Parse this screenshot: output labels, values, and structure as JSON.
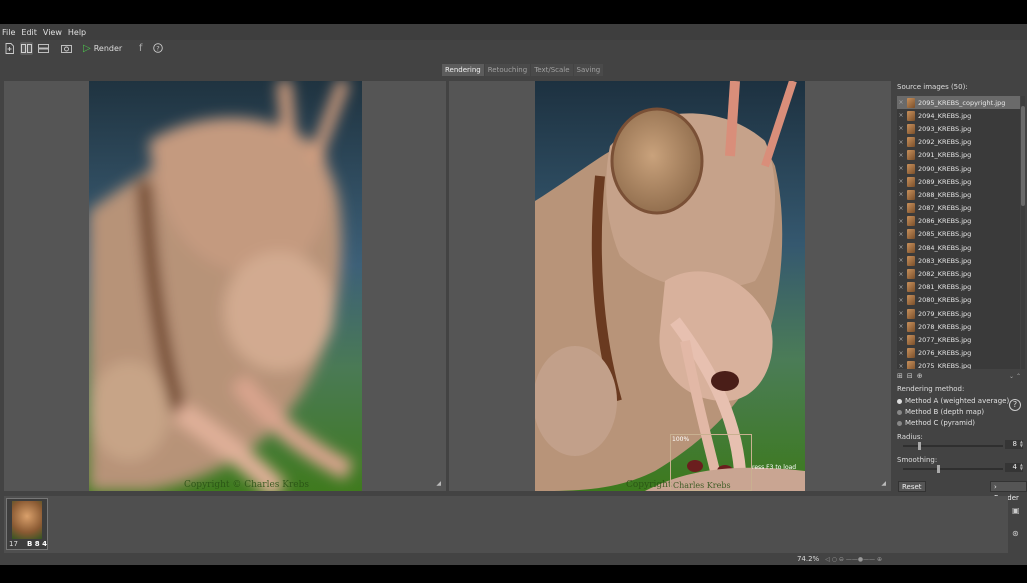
{
  "menu": [
    "File",
    "Edit",
    "View",
    "Help"
  ],
  "toolbar": {
    "icons": [
      "new-document-icon",
      "two-column-view-icon",
      "two-row-view-icon",
      "snapshot-icon",
      "play-icon",
      "facebook-icon",
      "help-icon"
    ],
    "render_label": "Render"
  },
  "tabs": [
    {
      "label": "Rendering",
      "active": true
    },
    {
      "label": "Retouching",
      "active": false
    },
    {
      "label": "Text/Scale",
      "active": false
    },
    {
      "label": "Saving",
      "active": false
    }
  ],
  "left_view": {
    "copyright": "Copyright © Charles Krebs"
  },
  "right_view": {
    "copyright": "Copyright",
    "loupe_zoom": "100%",
    "loupe_hint": "ress F3 to load",
    "loupe_text": "Charles Krebs"
  },
  "sidebar": {
    "title": "Source images (50):",
    "files": [
      "2095_KREBS_copyright.jpg",
      "2094_KREBS.jpg",
      "2093_KREBS.jpg",
      "2092_KREBS.jpg",
      "2091_KREBS.jpg",
      "2090_KREBS.jpg",
      "2089_KREBS.jpg",
      "2088_KREBS.jpg",
      "2087_KREBS.jpg",
      "2086_KREBS.jpg",
      "2085_KREBS.jpg",
      "2084_KREBS.jpg",
      "2083_KREBS.jpg",
      "2082_KREBS.jpg",
      "2081_KREBS.jpg",
      "2080_KREBS.jpg",
      "2079_KREBS.jpg",
      "2078_KREBS.jpg",
      "2077_KREBS.jpg",
      "2076_KREBS.jpg",
      "2075_KREBS.jpg"
    ],
    "selected_index": 0,
    "method_title": "Rendering method:",
    "methods": [
      "Method A (weighted average)",
      "Method B (depth map)",
      "Method C (pyramid)"
    ],
    "selected_method": 0,
    "radius_label": "Radius:",
    "radius_value": "8",
    "radius_fraction": 0.15,
    "smoothing_label": "Smoothing:",
    "smoothing_value": "4",
    "smoothing_fraction": 0.35,
    "reset_label": "Reset",
    "render_label": "› Render"
  },
  "filmstrip": {
    "thumb_label": "17",
    "thumb_badge": "B 8 4"
  },
  "status": {
    "zoom": "74.2%"
  }
}
